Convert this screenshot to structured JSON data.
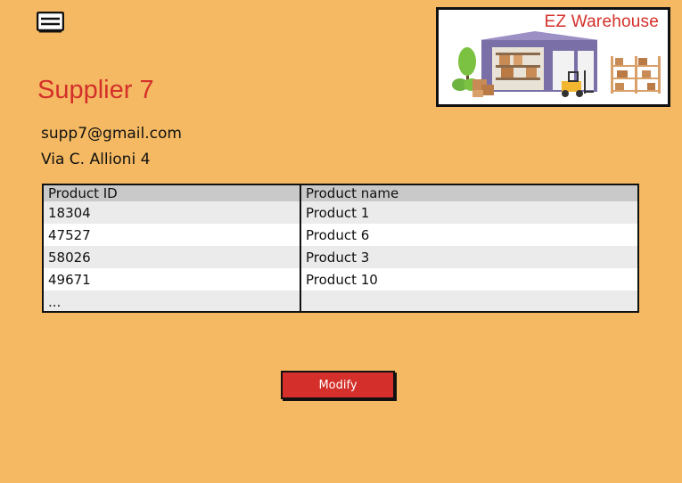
{
  "brand": {
    "name": "EZ Warehouse",
    "accent_color": "#d42f2a",
    "logo_icon": "warehouse-illustration"
  },
  "header": {
    "menu_icon": "hamburger-menu-icon"
  },
  "supplier": {
    "name": "Supplier 7",
    "email": "supp7@gmail.com",
    "address": "Via C. Allioni 4"
  },
  "products_table": {
    "columns": [
      "Product ID",
      "Product name"
    ],
    "rows": [
      [
        "18304",
        "Product 1"
      ],
      [
        "47527",
        "Product 6"
      ],
      [
        "58026",
        "Product 3"
      ],
      [
        "49671",
        "Product 10"
      ],
      [
        "...",
        ""
      ]
    ]
  },
  "actions": {
    "modify_label": "Modify",
    "button_color": "#d42f2a"
  },
  "colors": {
    "background": "#f4b962"
  }
}
